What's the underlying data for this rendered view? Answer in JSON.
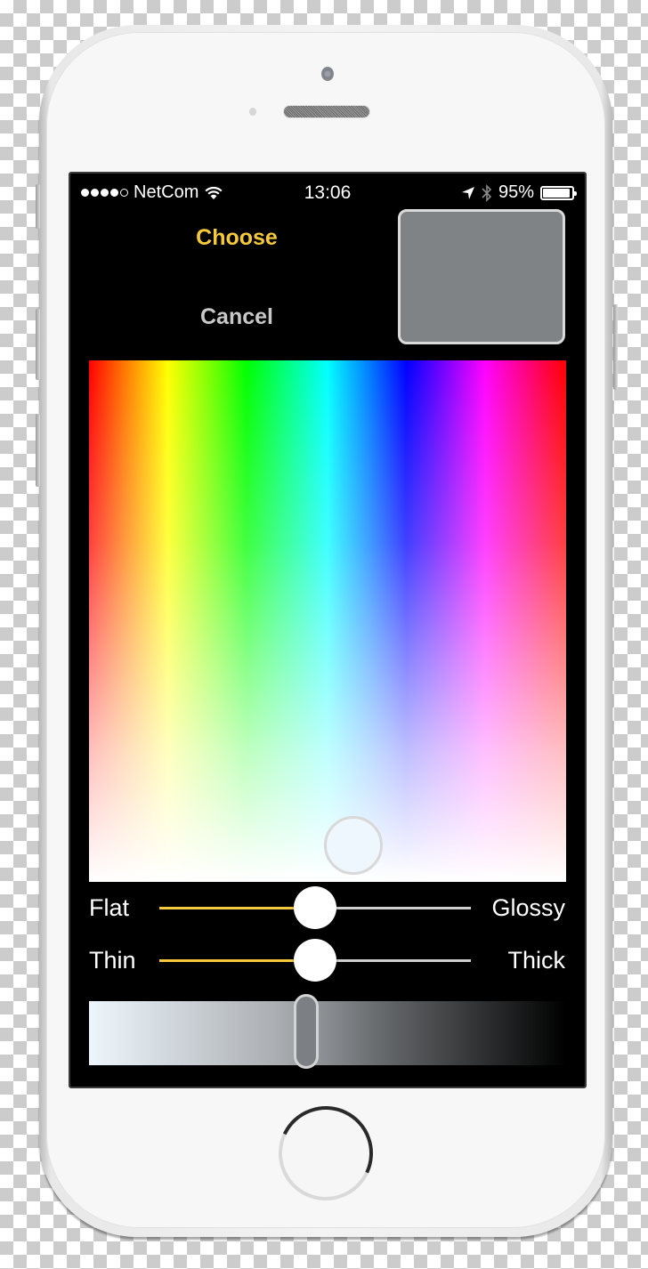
{
  "status_bar": {
    "carrier": "NetCom",
    "signal_bars_filled": 4,
    "signal_bars_total": 5,
    "time": "13:06",
    "battery_percent_label": "95%",
    "battery_level": 0.95,
    "icons": [
      "wifi-icon",
      "location-arrow-icon",
      "bluetooth-icon",
      "battery-icon"
    ]
  },
  "actions": {
    "choose_label": "Choose",
    "cancel_label": "Cancel"
  },
  "colors": {
    "accent": "#f6c93b",
    "selected_color": "#7f8386",
    "cancel_text": "#c8c8c8",
    "screen_background": "#000000"
  },
  "spectrum": {
    "picker_position": {
      "x_fraction": 0.555,
      "y_fraction": 0.93
    }
  },
  "sliders": [
    {
      "left_label": "Flat",
      "right_label": "Glossy",
      "value": 0.5
    },
    {
      "left_label": "Thin",
      "right_label": "Thick",
      "value": 0.5
    }
  ],
  "brightness": {
    "value": 0.455
  }
}
